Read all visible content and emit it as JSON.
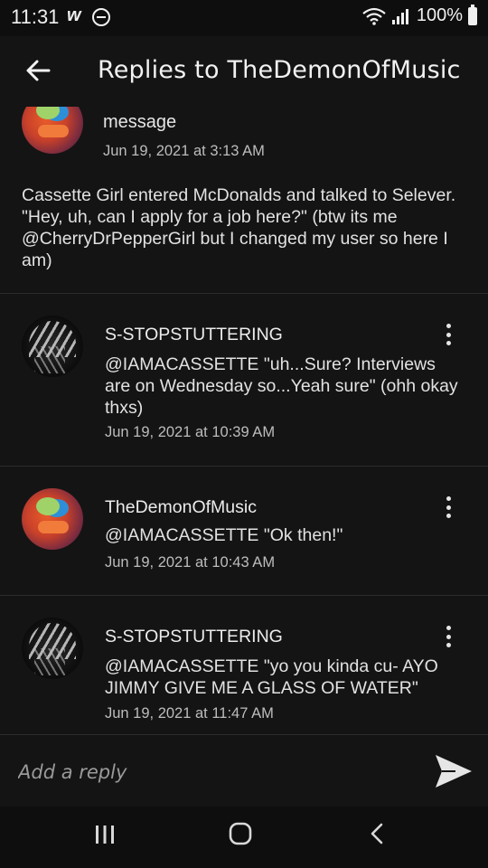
{
  "status_bar": {
    "time": "11:31",
    "app_icon_letter": "w",
    "battery_percent": "100%"
  },
  "app_bar": {
    "back_icon": "arrow-left-icon",
    "title": "Replies to TheDemonOfMusic"
  },
  "parent_comment": {
    "partial_text": "message",
    "date": "Jun 19, 2021 at 3:13 AM",
    "text": "Cassette Girl entered McDonalds and talked to Selever. \"Hey, uh, can I apply for a job here?\" (btw its me @CherryDrPepperGirl but I changed my user so here I am)"
  },
  "replies": [
    {
      "author": "S-STOPSTUTTERING",
      "text": "@IAMACASSETTE \"uh...Sure? Interviews are on Wednesday so...Yeah sure\" (ohh okay thxs)",
      "date": "Jun 19, 2021 at 10:39 AM"
    },
    {
      "author": "TheDemonOfMusic",
      "text": "@IAMACASSETTE \"Ok then!\"",
      "date": "Jun 19, 2021 at 10:43 AM"
    },
    {
      "author": "S-STOPSTUTTERING",
      "text": "@IAMACASSETTE \"yo you kinda cu- AYO JIMMY GIVE ME A GLASS OF WATER\"",
      "date": "Jun 19, 2021 at 11:47 AM"
    }
  ],
  "reply_bar": {
    "placeholder": "Add a reply",
    "send_icon": "send-icon"
  },
  "nav_bar": {
    "recent_icon": "recent-apps-icon",
    "home_icon": "home-icon",
    "back_icon": "nav-back-icon"
  },
  "colors": {
    "background": "#141414",
    "text": "#e2e2e2",
    "secondary_text": "#bdbdbd",
    "divider": "#2c2c2c"
  }
}
